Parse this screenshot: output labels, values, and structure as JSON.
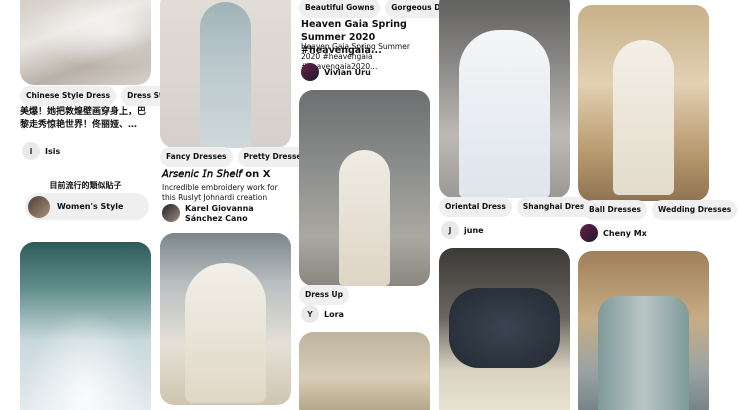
{
  "col1": {
    "chips": [
      "Chinese Style Dress",
      "Dress Style"
    ],
    "title": "美爆！她把敦煌壁画穿身上，巴黎走秀惊艳世界！佟丽娅、…",
    "user_initial": "I",
    "user_name": "Isis",
    "trending_heading": "目前流行的類似貼子",
    "trending_label": "Women's Style"
  },
  "col2": {
    "chips": [
      "Fancy Dresses",
      "Pretty Dresses"
    ],
    "title": "𝘈𝘳𝘴𝘦𝘯𝘪𝘤 𝘐𝘯 𝘚𝘩𝘦𝘭𝘧 on X",
    "desc": "Incredible embroidery work for this Ruslyt Johnardi creation",
    "user_name": "Karel Giovanna Sánchez Cano"
  },
  "col3": {
    "chips": [
      "Beautiful Gowns",
      "Gorgeous Dress"
    ],
    "title": "Heaven Gaia Spring Summer 2020 #heavengaia...",
    "desc": "Heaven Gaia Spring Summer 2020 #heavengaia #heavengaia2020...",
    "user_name": "Vivian Uru",
    "chips2": [
      "Dress Up"
    ],
    "user2_initial": "Y",
    "user2_name": "Lora"
  },
  "col4": {
    "chips": [
      "Oriental Dress",
      "Shanghai Dress"
    ],
    "user_initial": "J",
    "user_name": "june"
  },
  "col5": {
    "chips": [
      "Ball Dresses",
      "Wedding Dresses"
    ],
    "user_name": "Cheny Mx"
  },
  "icons": {
    "chevron": "›"
  }
}
